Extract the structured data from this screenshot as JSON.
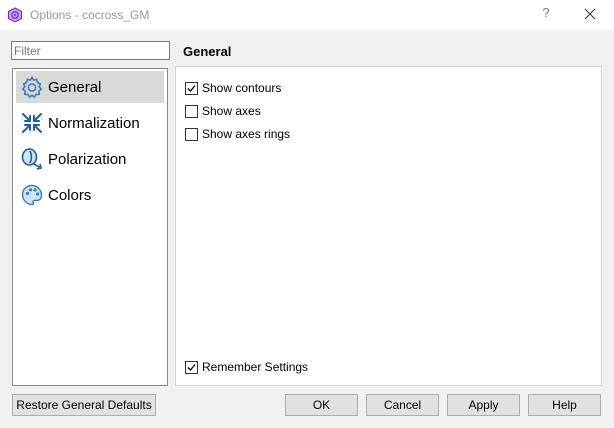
{
  "window": {
    "title": "Options - cocross_GM",
    "help_label": "?",
    "close_label": "✕"
  },
  "filter": {
    "placeholder": "Filter",
    "value": ""
  },
  "sidebar": {
    "items": [
      {
        "label": "General",
        "icon": "gear-icon",
        "selected": true
      },
      {
        "label": "Normalization",
        "icon": "normalization-icon",
        "selected": false
      },
      {
        "label": "Polarization",
        "icon": "polarization-icon",
        "selected": false
      },
      {
        "label": "Colors",
        "icon": "palette-icon",
        "selected": false
      }
    ]
  },
  "page": {
    "title": "General",
    "options": [
      {
        "label": "Show contours",
        "checked": true
      },
      {
        "label": "Show axes",
        "checked": false
      },
      {
        "label": "Show axes rings",
        "checked": false
      }
    ],
    "remember": {
      "label": "Remember Settings",
      "checked": true
    }
  },
  "buttons": {
    "restore": "Restore General Defaults",
    "ok": "OK",
    "cancel": "Cancel",
    "apply": "Apply",
    "help": "Help"
  },
  "colors": {
    "accent_icon": "#3a7bbf",
    "app_icon": "#8a2be2",
    "selected_bg": "#d9d9d9"
  }
}
